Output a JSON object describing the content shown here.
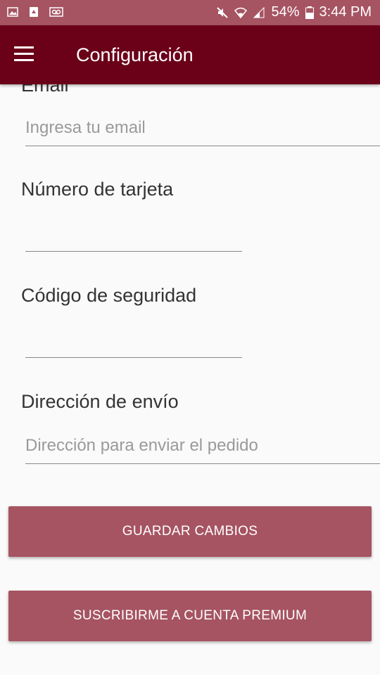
{
  "status_bar": {
    "battery": "54%",
    "time": "3:44 PM"
  },
  "app_bar": {
    "title": "Configuración"
  },
  "form": {
    "email_label": "Email",
    "email_placeholder": "Ingresa tu email",
    "card_label": "Número de tarjeta",
    "security_label": "Código de seguridad",
    "address_label": "Dirección de envío",
    "address_placeholder": "Dirección para enviar el pedido"
  },
  "buttons": {
    "save": "GUARDAR CAMBIOS",
    "premium": "SUSCRIBIRME A CUENTA PREMIUM"
  },
  "colors": {
    "app_bar": "#6b0019",
    "status_bar": "#a65462",
    "button": "#a65462"
  }
}
